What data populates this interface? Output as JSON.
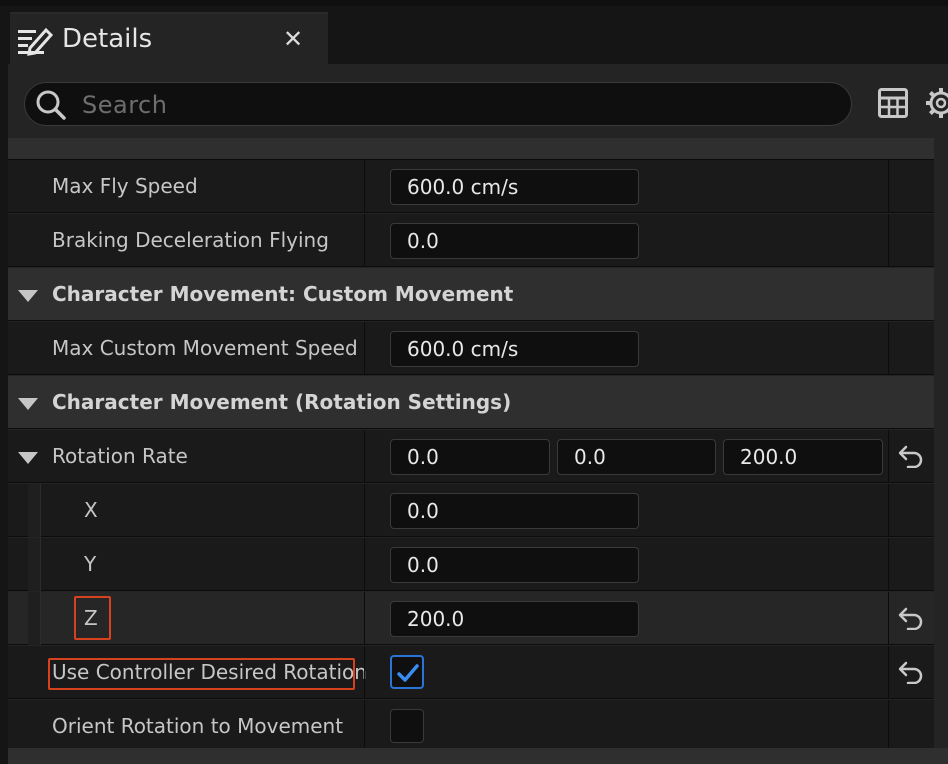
{
  "tab": {
    "title": "Details",
    "close": "✕"
  },
  "search": {
    "placeholder": "Search",
    "value": ""
  },
  "rows": {
    "max_fly_speed": {
      "label": "Max Fly Speed",
      "value": "600.0 cm/s"
    },
    "braking_decel_flying": {
      "label": "Braking Deceleration Flying",
      "value": "0.0"
    },
    "cat_custom": {
      "label": "Character Movement: Custom Movement"
    },
    "max_custom_speed": {
      "label": "Max Custom Movement Speed",
      "value": "600.0 cm/s"
    },
    "cat_rotation": {
      "label": "Character Movement (Rotation Settings)"
    },
    "rotation_rate": {
      "label": "Rotation Rate",
      "x": "0.0",
      "y": "0.0",
      "z": "200.0"
    },
    "rot_x": {
      "label": "X",
      "value": "0.0"
    },
    "rot_y": {
      "label": "Y",
      "value": "0.0"
    },
    "rot_z": {
      "label": "Z",
      "value": "200.0"
    },
    "use_controller_rot": {
      "label": "Use Controller Desired Rotation",
      "checked": true
    },
    "orient_rot": {
      "label": "Orient Rotation to Movement",
      "checked": false
    }
  },
  "colors": {
    "highlight_box": "#d8411e",
    "checkbox_accent": "#2b74d6"
  }
}
